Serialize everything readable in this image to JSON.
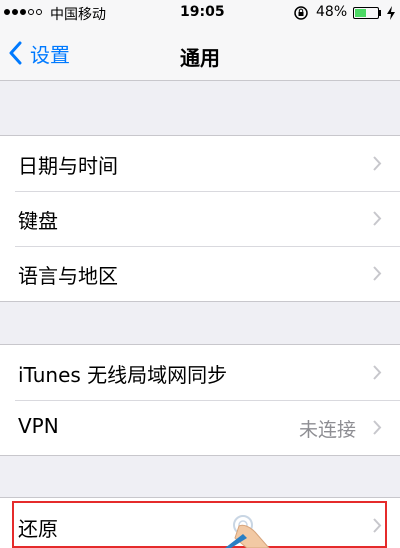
{
  "status_bar": {
    "carrier": "中国移动",
    "time": "19:05",
    "battery": "48%",
    "battery_level": 0.48,
    "battery_color": "#4cd964"
  },
  "nav": {
    "back_label": "设置",
    "title": "通用",
    "accent": "#007aff"
  },
  "groups": [
    {
      "rows": [
        {
          "label": "日期与时间"
        },
        {
          "label": "键盘"
        },
        {
          "label": "语言与地区"
        }
      ]
    },
    {
      "rows": [
        {
          "label": "iTunes 无线局域网同步"
        },
        {
          "label": "VPN",
          "value": "未连接"
        }
      ]
    },
    {
      "rows": [
        {
          "label": "还原"
        }
      ]
    }
  ],
  "icons": [
    "chevron-left-icon",
    "rotation-lock-icon",
    "battery-icon",
    "charging-icon",
    "chevron-right-icon",
    "pointing-hand-icon"
  ]
}
